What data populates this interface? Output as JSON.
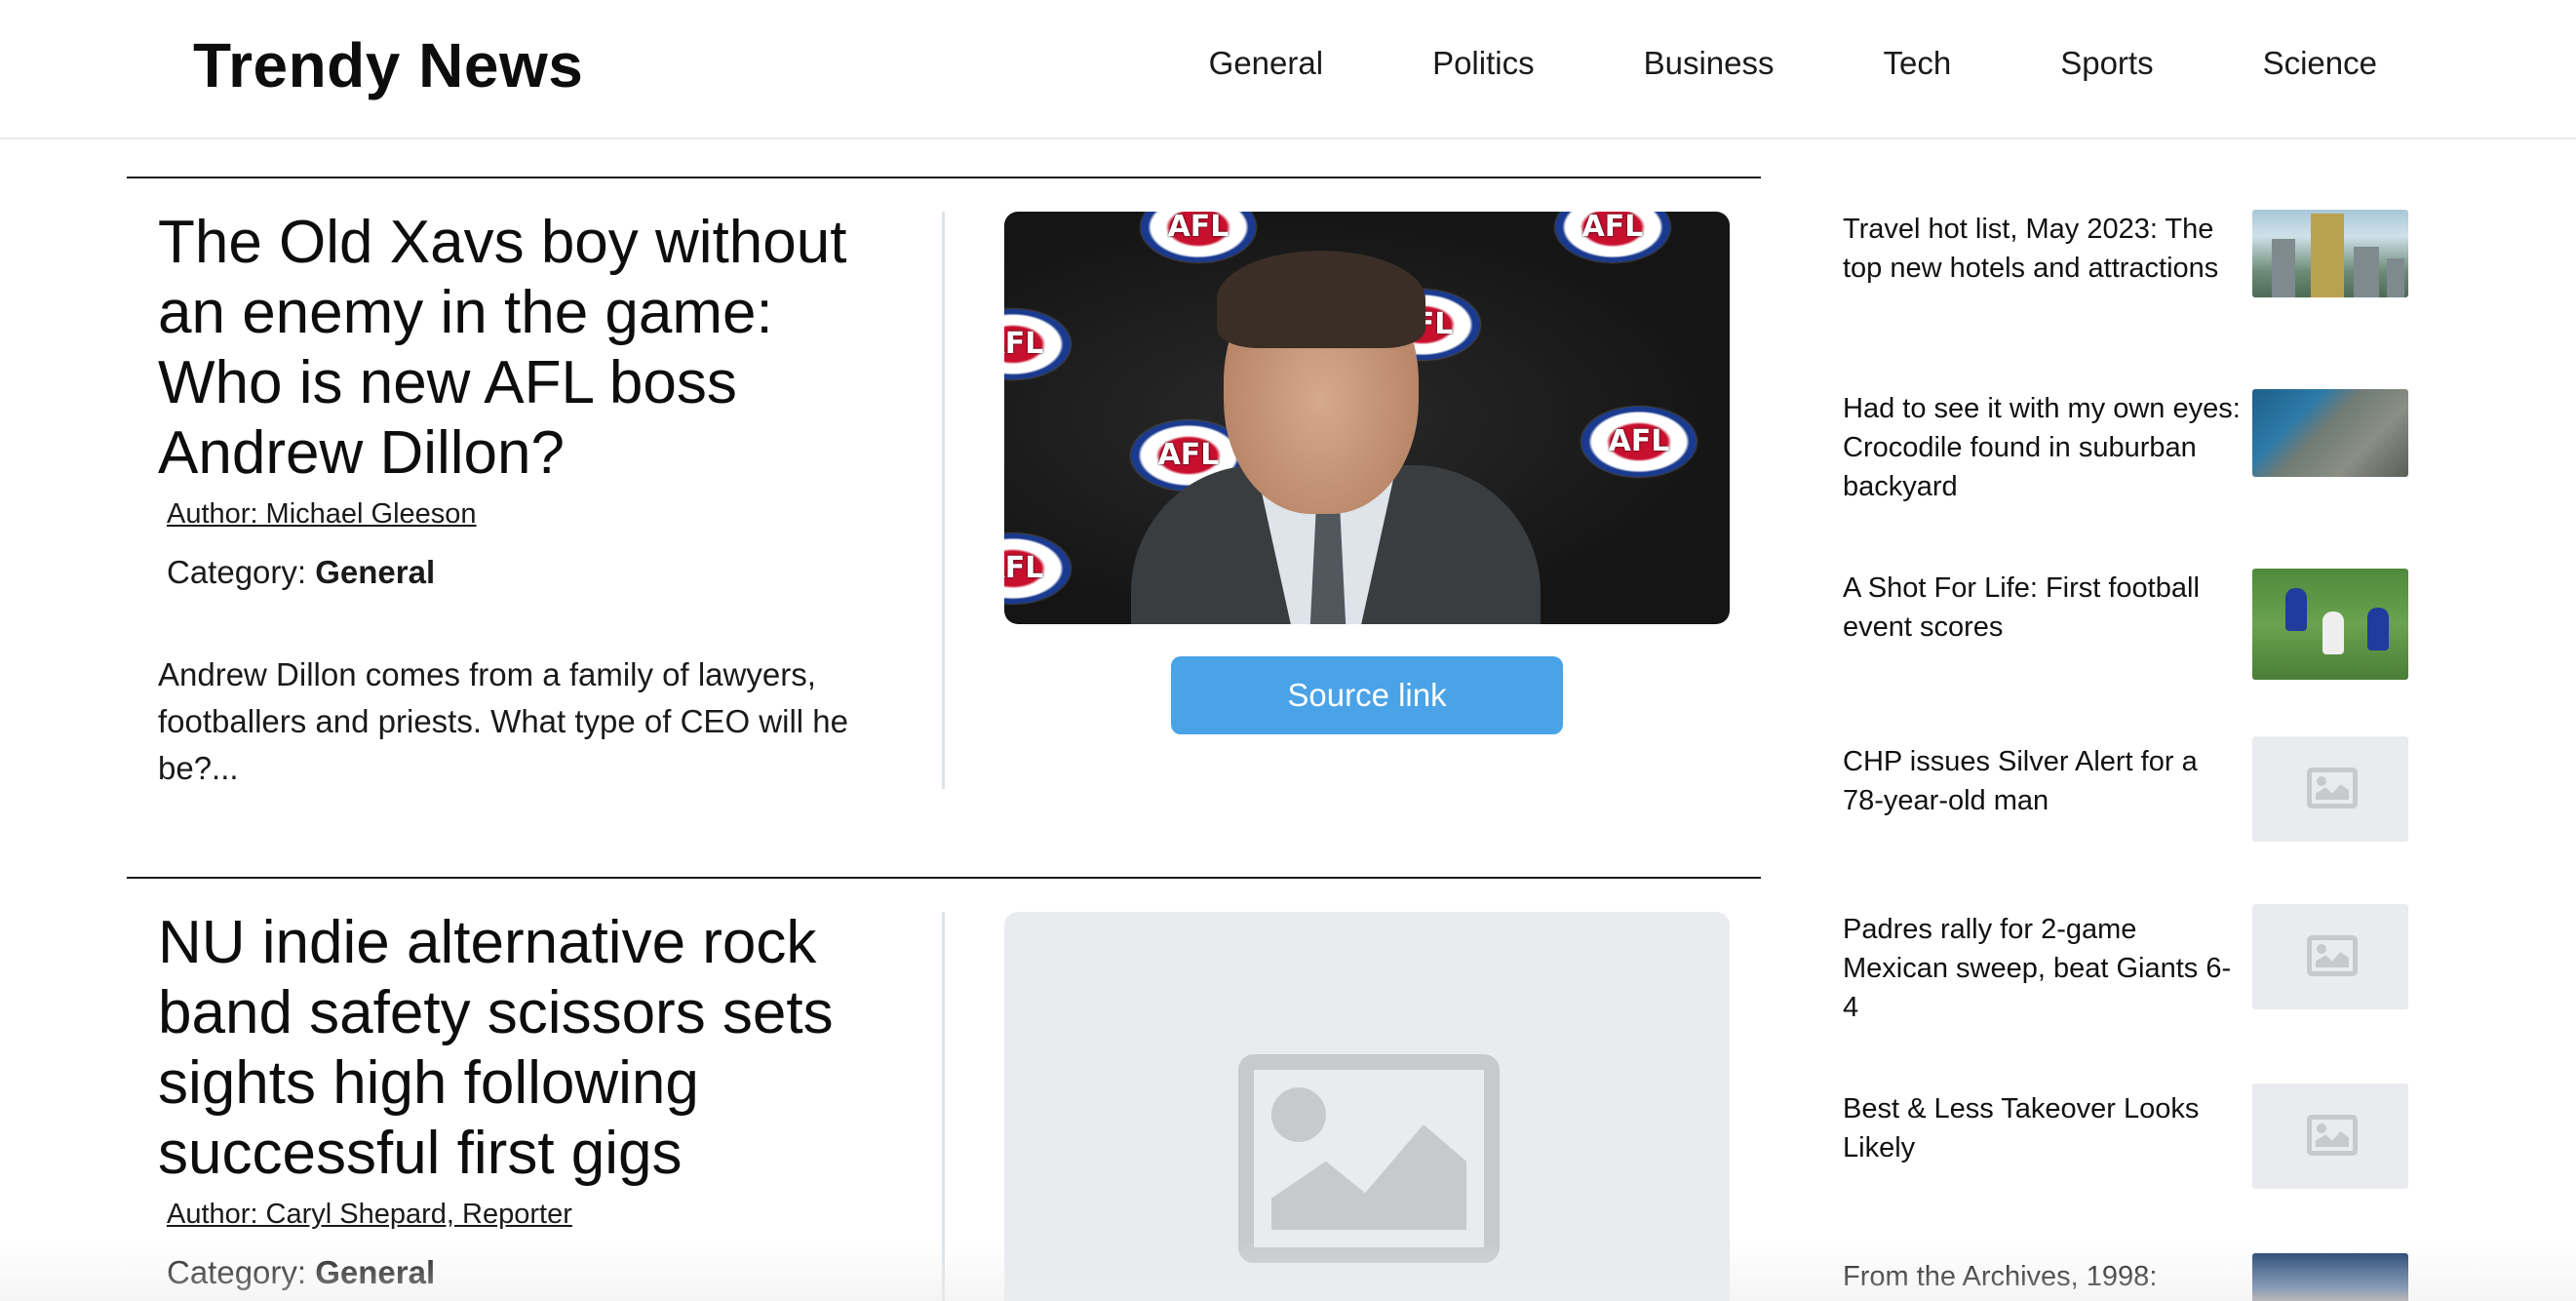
{
  "header": {
    "logo": "Trendy News",
    "nav": [
      "General",
      "Politics",
      "Business",
      "Tech",
      "Sports",
      "Science"
    ]
  },
  "articles": [
    {
      "title": "The Old Xavs boy without an enemy in the game: Who is new AFL boss Andrew Dillon?",
      "author": "Author: Michael Gleeson",
      "category_label": "Category:",
      "category": "General",
      "excerpt": "Andrew Dillon comes from a family of lawyers, footballers and priests. What type of CEO will he be?...",
      "image": "photo-afl-press-conference",
      "image_logo_text": "AFL",
      "source_button": "Source link"
    },
    {
      "title": "NU indie alternative rock band safety scissors sets sights high following successful first gigs",
      "author": "Author: Caryl Shepard, Reporter",
      "category_label": "Category:",
      "category": "General",
      "image": "image-placeholder-icon"
    }
  ],
  "sidebar": {
    "items": [
      {
        "title": "Travel hot list, May 2023: The top new hotels and attractions",
        "thumb": "city-photo"
      },
      {
        "title": "Had to see it with my own eyes: Crocodile found in suburban backyard",
        "thumb": "crocodile-photo"
      },
      {
        "title": "A Shot For Life: First football event scores",
        "thumb": "football-photo"
      },
      {
        "title": "CHP issues Silver Alert for a 78-year-old man",
        "thumb": "image-placeholder-icon"
      },
      {
        "title": "Padres rally for 2-game Mexican sweep, beat Giants 6-4",
        "thumb": "image-placeholder-icon"
      },
      {
        "title": "Best & Less Takeover Looks Likely",
        "thumb": "image-placeholder-icon"
      },
      {
        "title": "From the Archives, 1998:",
        "thumb": "archive-photo"
      }
    ]
  },
  "colors": {
    "accent": "#4aa3e6",
    "placeholder_bg": "#e9ebee",
    "placeholder_icon": "#c7c9cb",
    "divider": "#dde3ea"
  }
}
